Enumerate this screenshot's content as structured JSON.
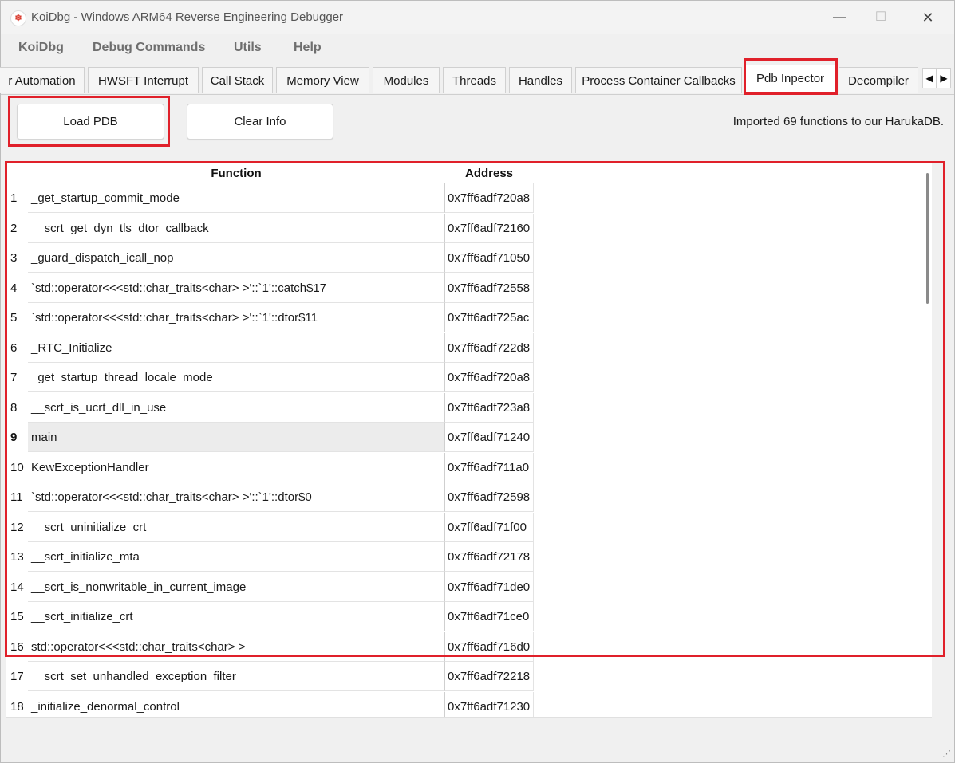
{
  "window": {
    "title": "KoiDbg - Windows ARM64 Reverse Engineering Debugger",
    "app_icon_text": "❄",
    "controls": {
      "minimize": "—",
      "maximize": "☐",
      "close": "✕"
    }
  },
  "menu": {
    "items": [
      "KoiDbg",
      "Debug Commands",
      "Utils",
      "Help"
    ]
  },
  "tabs": {
    "items": [
      "r Automation",
      "HWSFT Interrupt",
      "Call Stack",
      "Memory View",
      "Modules",
      "Threads",
      "Handles",
      "Process Container Callbacks",
      "Pdb Inpector",
      "Decompiler"
    ],
    "active": "Pdb Inpector",
    "scroll_left": "◀",
    "scroll_right": "▶"
  },
  "toolbar": {
    "load_label": "Load PDB",
    "clear_label": "Clear Info",
    "status": "Imported 69 functions to our HarukaDB."
  },
  "table": {
    "columns": [
      "Function",
      "Address"
    ],
    "selected_row": 9,
    "rows": [
      {
        "num": "1",
        "function": "_get_startup_commit_mode",
        "address": "0x7ff6adf720a8"
      },
      {
        "num": "2",
        "function": "__scrt_get_dyn_tls_dtor_callback",
        "address": "0x7ff6adf72160"
      },
      {
        "num": "3",
        "function": "_guard_dispatch_icall_nop",
        "address": "0x7ff6adf71050"
      },
      {
        "num": "4",
        "function": "`std::operator<<<std::char_traits<char> >'::`1'::catch$17",
        "address": "0x7ff6adf72558"
      },
      {
        "num": "5",
        "function": "`std::operator<<<std::char_traits<char> >'::`1'::dtor$11",
        "address": "0x7ff6adf725ac"
      },
      {
        "num": "6",
        "function": "_RTC_Initialize",
        "address": "0x7ff6adf722d8"
      },
      {
        "num": "7",
        "function": "_get_startup_thread_locale_mode",
        "address": "0x7ff6adf720a8"
      },
      {
        "num": "8",
        "function": "__scrt_is_ucrt_dll_in_use",
        "address": "0x7ff6adf723a8"
      },
      {
        "num": "9",
        "function": "main",
        "address": "0x7ff6adf71240"
      },
      {
        "num": "10",
        "function": "KewExceptionHandler",
        "address": "0x7ff6adf711a0"
      },
      {
        "num": "11",
        "function": "`std::operator<<<std::char_traits<char> >'::`1'::dtor$0",
        "address": "0x7ff6adf72598"
      },
      {
        "num": "12",
        "function": "__scrt_uninitialize_crt",
        "address": "0x7ff6adf71f00"
      },
      {
        "num": "13",
        "function": "__scrt_initialize_mta",
        "address": "0x7ff6adf72178"
      },
      {
        "num": "14",
        "function": "__scrt_is_nonwritable_in_current_image",
        "address": "0x7ff6adf71de0"
      },
      {
        "num": "15",
        "function": "__scrt_initialize_crt",
        "address": "0x7ff6adf71ce0"
      },
      {
        "num": "16",
        "function": "std::operator<<<std::char_traits<char> >",
        "address": "0x7ff6adf716d0"
      },
      {
        "num": "17",
        "function": "__scrt_set_unhandled_exception_filter",
        "address": "0x7ff6adf72218"
      },
      {
        "num": "18",
        "function": "_initialize_denormal_control",
        "address": "0x7ff6adf71230"
      }
    ]
  },
  "colors": {
    "highlight": "#e0202a",
    "selected_row": "#ececec"
  }
}
